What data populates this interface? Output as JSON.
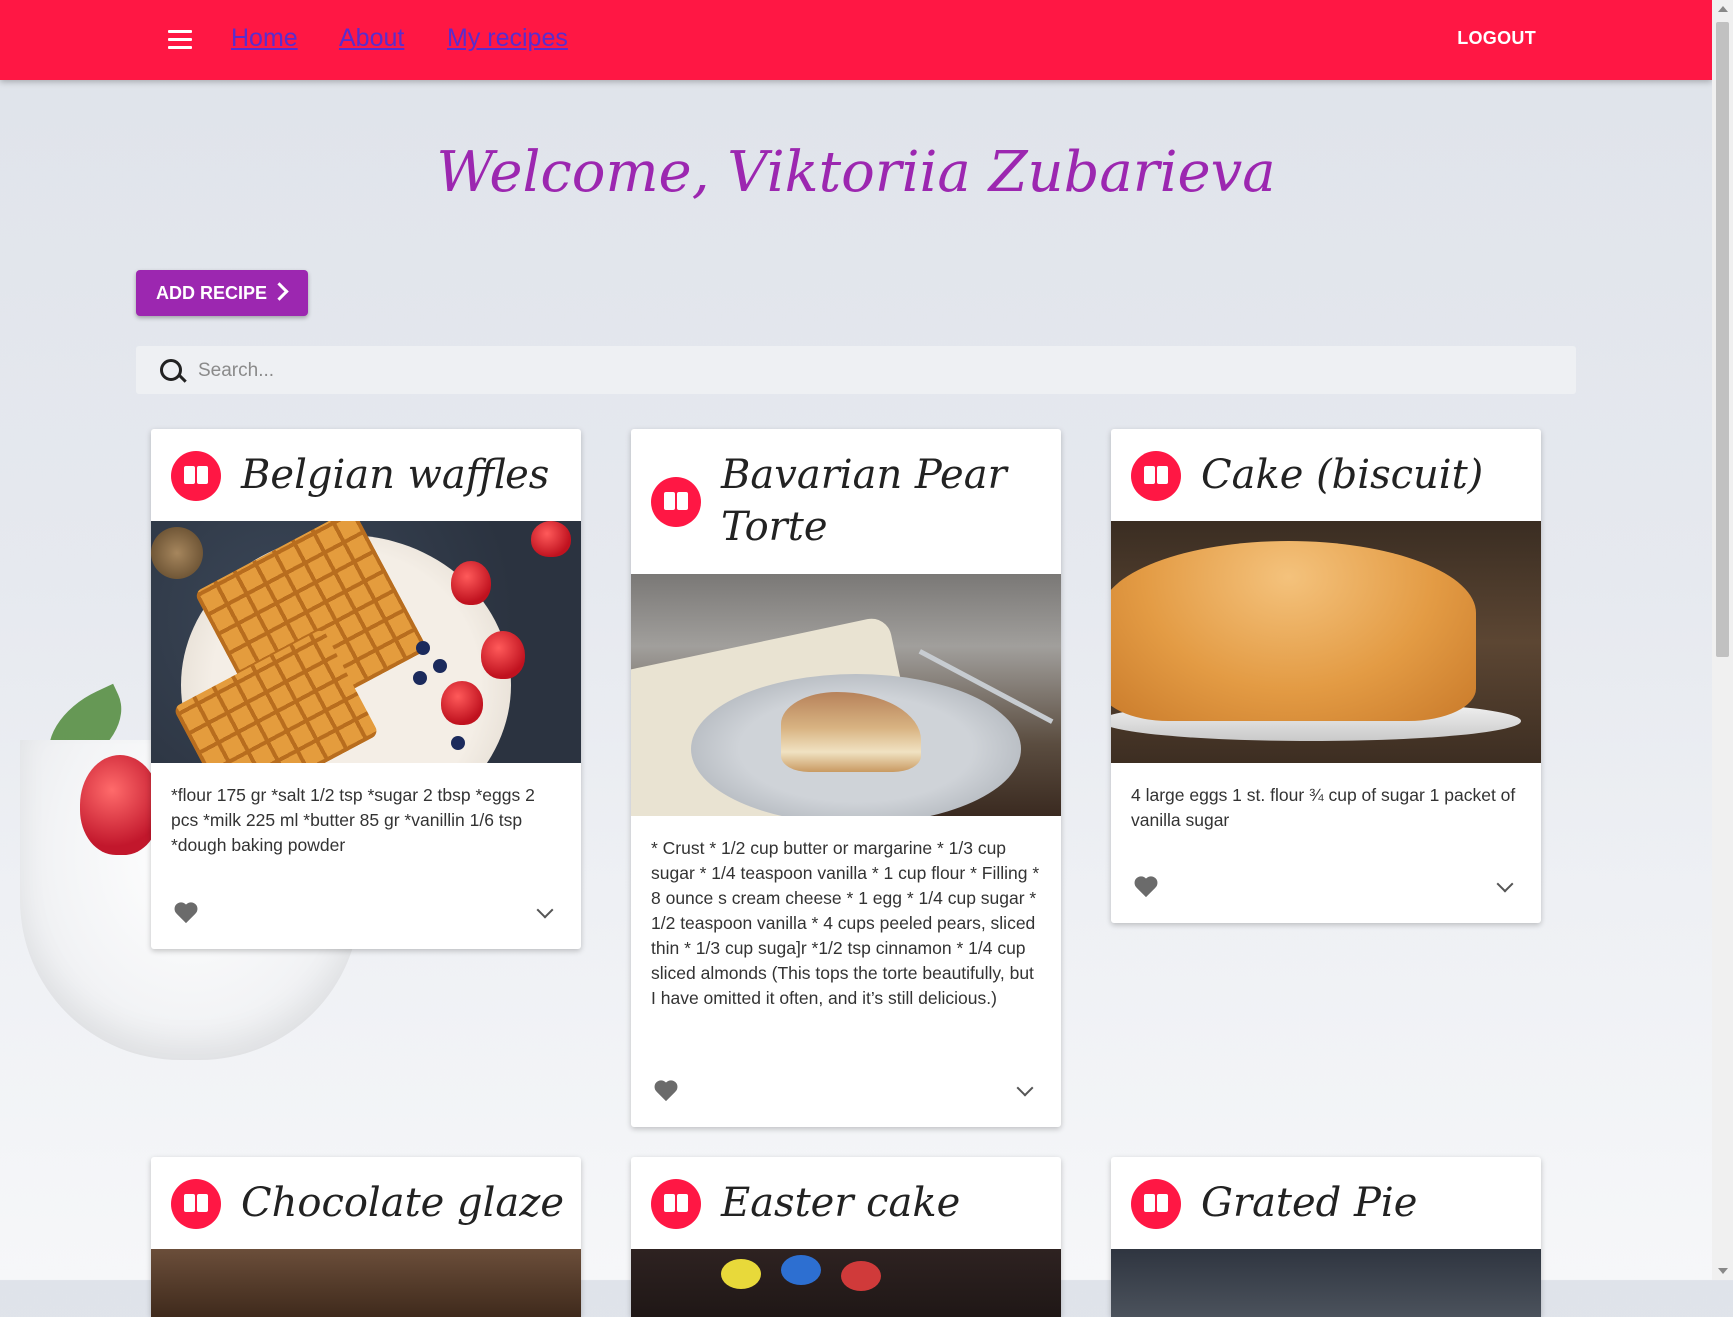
{
  "nav": {
    "links": [
      "Home",
      "About",
      "My recipes"
    ],
    "logout": "LOGOUT"
  },
  "welcome": "Welcome, Viktoriia Zubarieva",
  "add_recipe": "ADD RECIPE",
  "search": {
    "placeholder": "Search..."
  },
  "colors": {
    "appbar": "#ff1744",
    "accent": "#9c27b0",
    "link": "#5a2dcc"
  },
  "cards": [
    {
      "title": "Belgian waffles",
      "text": "*flour 175 gr *salt 1/2 tsp *sugar 2 tbsp *eggs 2 pcs *milk 225 ml *butter 85 gr *vanillin 1/6 tsp *dough baking powder"
    },
    {
      "title": "Bavarian Pear Torte",
      "text": "* Crust * 1/2 cup butter or margarine * 1/3 cup sugar * 1/4 teaspoon vanilla * 1 cup flour * Filling * 8 ounce s cream cheese * 1 egg * 1/4 cup sugar * 1/2 teaspoon vanilla * 4 cups peeled pears, sliced thin * 1/3 cup suga]r *1/2 tsp cinnamon * 1/4 cup sliced almonds (This tops the torte beautifully, but I have omitted it often, and it’s still delicious.)"
    },
    {
      "title": "Cake (biscuit)",
      "text": "4 large eggs 1 st. flour ¾ cup of sugar 1 packet of vanilla sugar"
    },
    {
      "title": "Chocolate glaze"
    },
    {
      "title": "Easter cake"
    },
    {
      "title": "Grated Pie"
    }
  ]
}
